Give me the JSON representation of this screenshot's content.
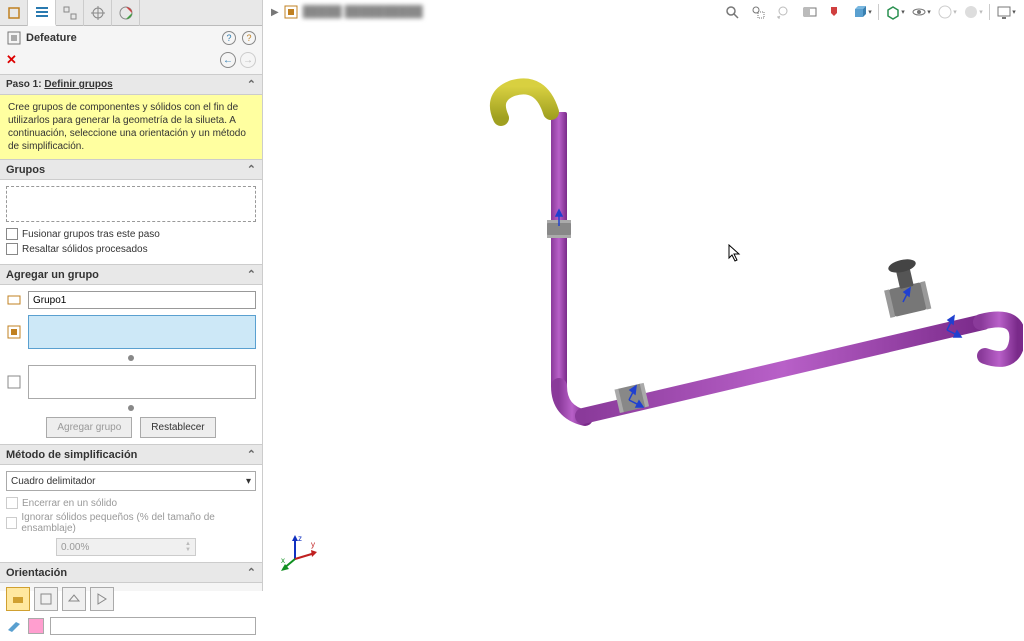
{
  "header": {
    "title": "Defeature",
    "breadcrumb": "█████ ██████████"
  },
  "step": {
    "num": "Paso 1:",
    "name": "Definir grupos",
    "tip": "Cree grupos de componentes y sólidos con el fin de utilizarlos para generar la geometría de la silueta. A continuación, seleccione una orientación y un método de simplificación."
  },
  "sections": {
    "grupos": "Grupos",
    "agregar": "Agregar un grupo",
    "metodo": "Método de simplificación",
    "orient": "Orientación"
  },
  "checks": {
    "merge": "Fusionar grupos tras este paso",
    "highlight": "Resaltar sólidos procesados",
    "enclose": "Encerrar en un sólido",
    "ignore": "Ignorar sólidos pequeños (% del tamaño de ensamblaje)"
  },
  "add_group": {
    "name_value": "Grupo1"
  },
  "buttons": {
    "add": "Agregar grupo",
    "reset": "Restablecer"
  },
  "method": {
    "selected": "Cuadro delimitador",
    "pct": "0.00%"
  },
  "icons": {
    "help": "?",
    "tut": "?",
    "back": "←",
    "fwd": "→",
    "close": "✕",
    "chev": "⌃",
    "dd": "▾"
  }
}
